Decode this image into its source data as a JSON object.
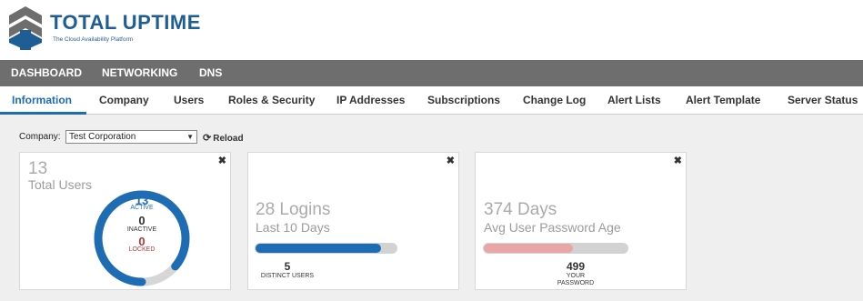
{
  "brand": {
    "title_word1": "TOTAL",
    "title_word2": "UPTIME",
    "tagline": "The Cloud Availability Platform",
    "logo_icon": "total-uptime-logo",
    "accent_color": "#1e6cb3"
  },
  "topnav": {
    "items": [
      "DASHBOARD",
      "NETWORKING",
      "DNS"
    ]
  },
  "subnav": {
    "tabs": [
      "Information",
      "Company",
      "Users",
      "Roles & Security",
      "IP Addresses",
      "Subscriptions",
      "Change Log",
      "Alert Lists",
      "Alert Template",
      "Server Status"
    ],
    "active": "Information"
  },
  "company": {
    "label": "Company:",
    "selected": "Test Corporation",
    "reload_label": "Reload"
  },
  "cards": {
    "users": {
      "total": "13",
      "total_label": "Total Users",
      "active_count": "13",
      "active_label": "ACTIVE",
      "inactive_count": "0",
      "inactive_label": "INACTIVE",
      "locked_count": "0",
      "locked_label": "LOCKED",
      "active_fraction": 0.86
    },
    "logins": {
      "count": "28 Logins",
      "period": "Last 10 Days",
      "distinct_users": "5",
      "distinct_label": "DISTINCT USERS",
      "bar_fraction": 0.89
    },
    "password": {
      "days": "374 Days",
      "label": "Avg User Password Age",
      "your_value": "499",
      "your_label_1": "YOUR",
      "your_label_2": "PASSWORD",
      "bar_fraction": 0.62
    }
  }
}
